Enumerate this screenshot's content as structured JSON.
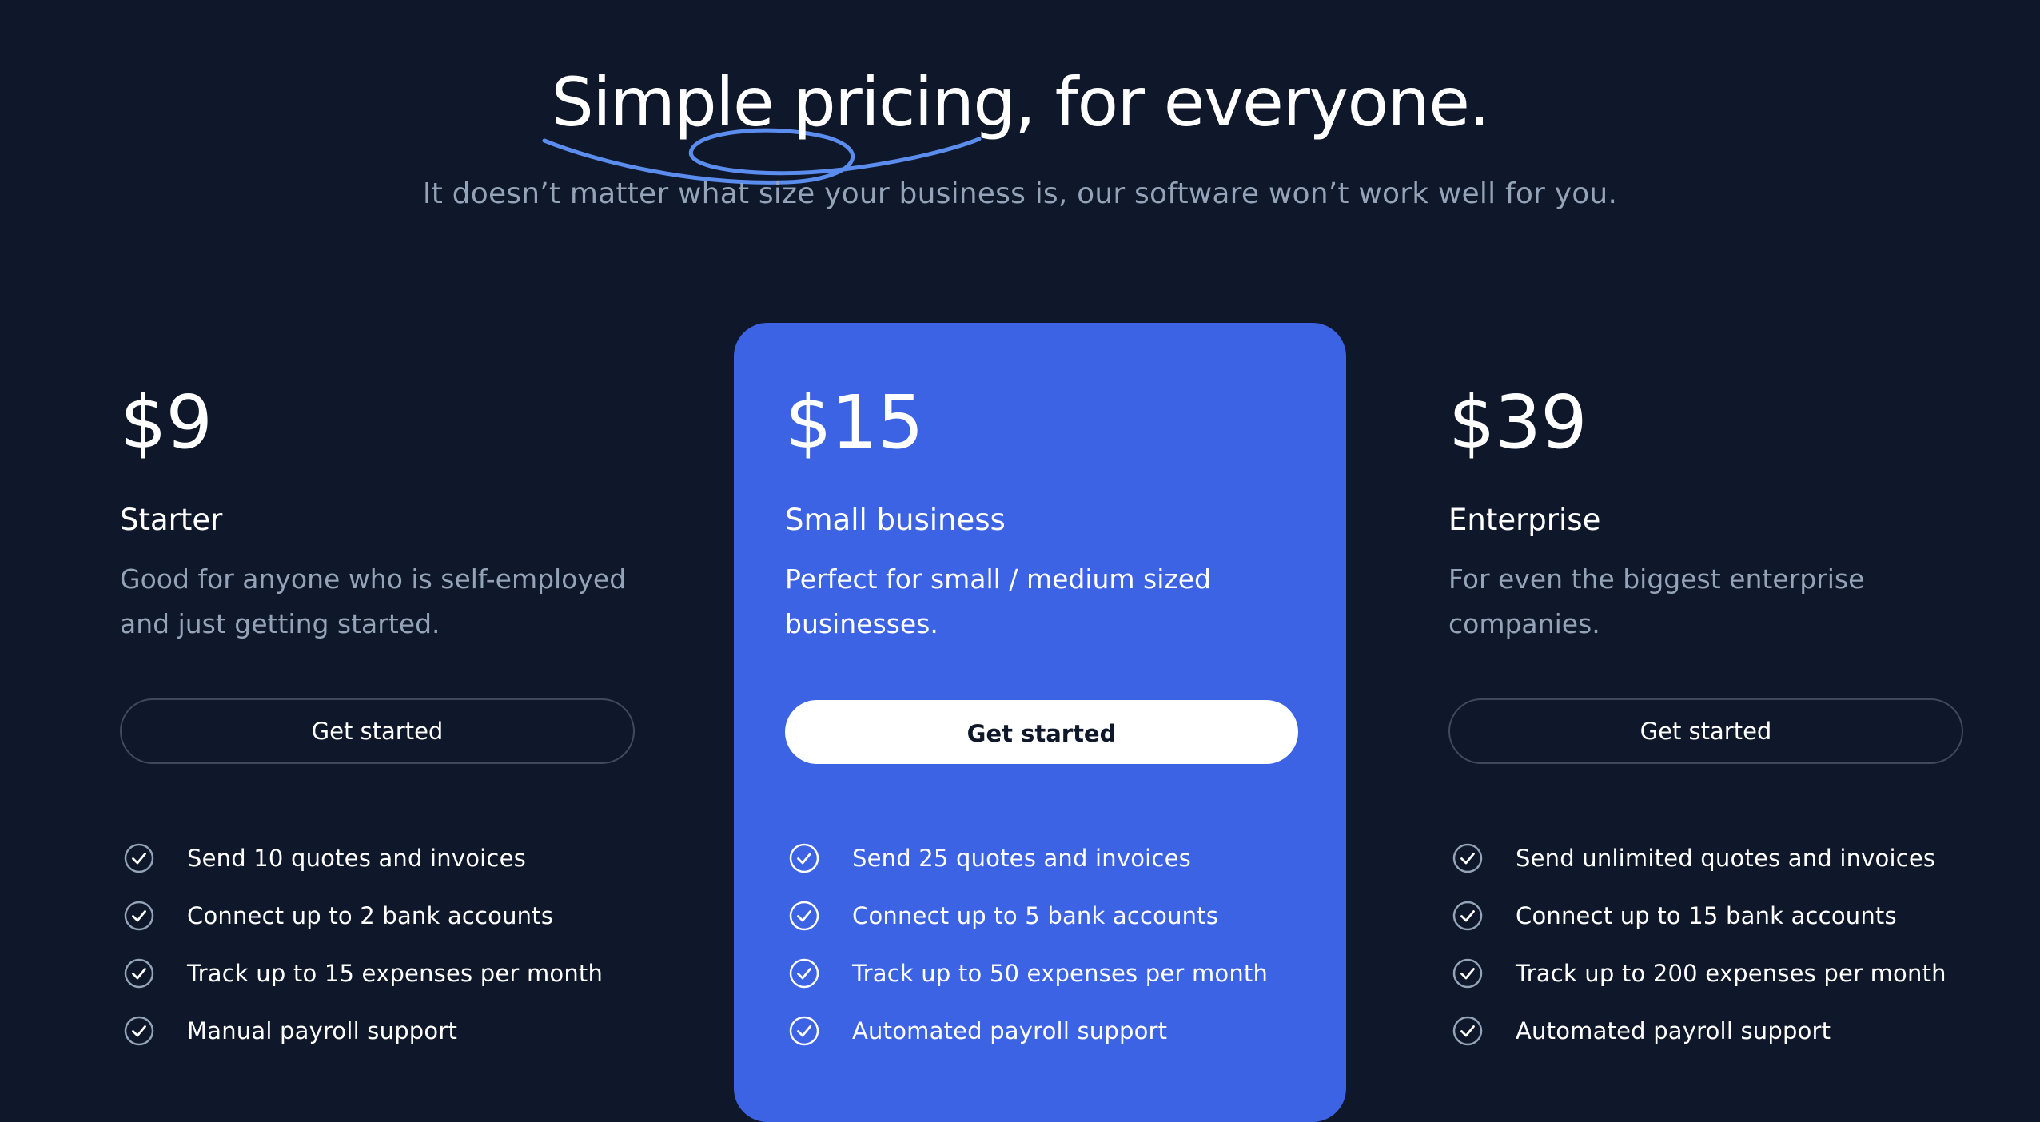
{
  "hero": {
    "headline_accent": "Simple pricing",
    "headline_rest": ", for everyone.",
    "subheadline": "It doesn’t matter what size your business is, our software won’t work well for you."
  },
  "colors": {
    "background": "#0f172a",
    "featured_card": "#3b63e3",
    "muted_text": "#94a3b8",
    "swoosh": "#5b8def",
    "check_muted": "#94a3b8"
  },
  "plans": [
    {
      "price": "$9",
      "name": "Starter",
      "description": "Good for anyone who is self-employed and just getting started.",
      "cta": "Get started",
      "featured": false,
      "features": [
        "Send 10 quotes and invoices",
        "Connect up to 2 bank accounts",
        "Track up to 15 expenses per month",
        "Manual payroll support"
      ]
    },
    {
      "price": "$15",
      "name": "Small business",
      "description": "Perfect for small / medium sized businesses.",
      "cta": "Get started",
      "featured": true,
      "features": [
        "Send 25 quotes and invoices",
        "Connect up to 5 bank accounts",
        "Track up to 50 expenses per month",
        "Automated payroll support"
      ]
    },
    {
      "price": "$39",
      "name": "Enterprise",
      "description": "For even the biggest enterprise companies.",
      "cta": "Get started",
      "featured": false,
      "features": [
        "Send unlimited quotes and invoices",
        "Connect up to 15 bank accounts",
        "Track up to 200 expenses per month",
        "Automated payroll support"
      ]
    }
  ],
  "icons": {
    "feature_check": "check-circle-icon",
    "headline_decoration": "swoosh-underline-icon"
  }
}
